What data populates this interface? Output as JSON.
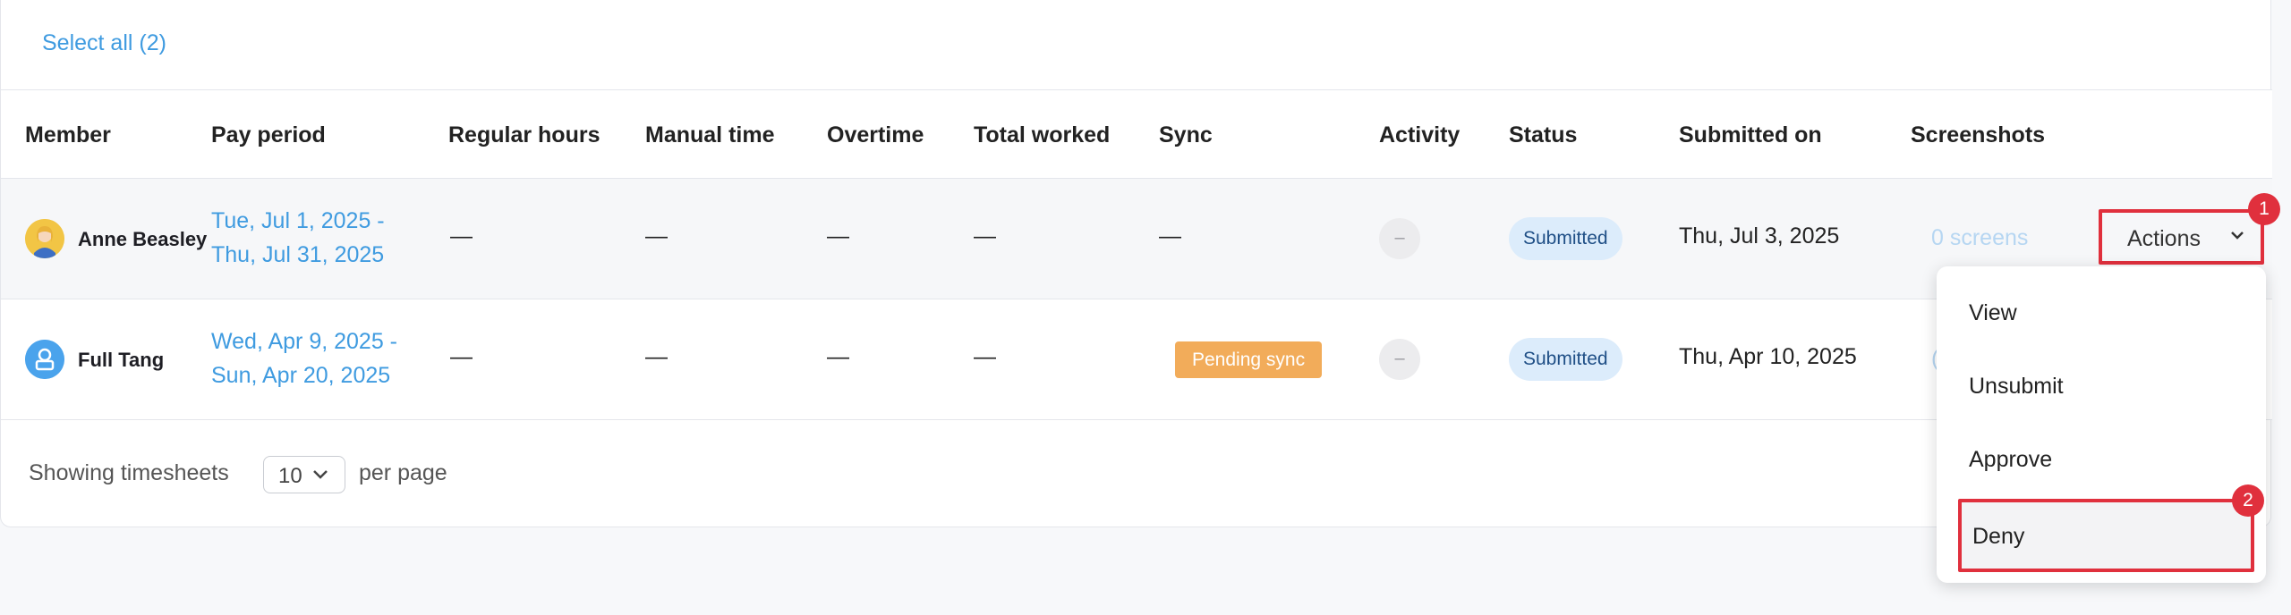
{
  "select_all_label": "Select all (2)",
  "columns": [
    "Member",
    "Pay period",
    "Regular hours",
    "Manual time",
    "Overtime",
    "Total worked",
    "Sync",
    "Activity",
    "Status",
    "Submitted on",
    "Screenshots"
  ],
  "rows": [
    {
      "member": "Anne Beasley",
      "period_start": "Tue, Jul 1, 2025 -",
      "period_end": "Thu, Jul 31, 2025",
      "regular_hours": "—",
      "manual_time": "—",
      "overtime": "—",
      "total_worked": "—",
      "sync": "—",
      "activity": "–",
      "status": "Submitted",
      "submitted_on": "Thu, Jul 3, 2025",
      "screenshots": "0 screens"
    },
    {
      "member": "Full Tang",
      "period_start": "Wed, Apr 9, 2025 -",
      "period_end": "Sun, Apr 20, 2025",
      "regular_hours": "—",
      "manual_time": "—",
      "overtime": "—",
      "total_worked": "—",
      "sync": "Pending sync",
      "activity": "–",
      "status": "Submitted",
      "submitted_on": "Thu, Apr 10, 2025",
      "screenshots": "("
    }
  ],
  "actions_label": "Actions",
  "footer": {
    "showing": "Showing timesheets",
    "per_page_value": "10",
    "per_page": "per page"
  },
  "dropdown": [
    "View",
    "Unsubmit",
    "Approve",
    "Deny"
  ],
  "markers": [
    "1",
    "2"
  ],
  "colors": {
    "link": "#3f9be0",
    "badge_submitted_bg": "#dcecfb",
    "pending_sync": "#f2ac5a",
    "highlight": "#e0303d"
  }
}
